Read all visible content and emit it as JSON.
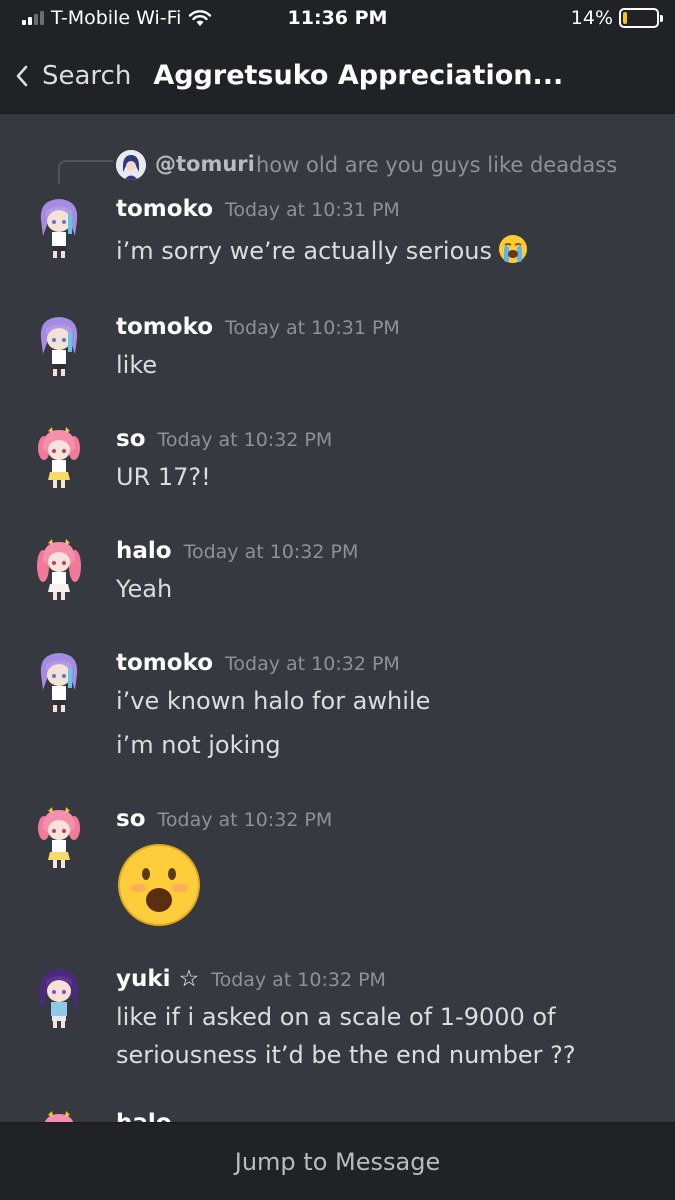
{
  "status_bar": {
    "carrier": "T-Mobile Wi-Fi",
    "time": "11:36 PM",
    "battery": "14%",
    "battery_level": 0.14
  },
  "header": {
    "back_label": "Search",
    "channel_title": "Aggretsuko Appreciation..."
  },
  "reply": {
    "name": "@tomuri",
    "text": "how old are you guys like deadass"
  },
  "messages": [
    {
      "author": "tomoko",
      "timestamp": "Today at 10:31 PM",
      "lines": [
        "i’m sorry we’re actually serious"
      ],
      "emoji": "loudly-crying-face"
    },
    {
      "author": "tomoko",
      "timestamp": "Today at 10:31 PM",
      "lines": [
        "like"
      ]
    },
    {
      "author": "so",
      "timestamp": "Today at 10:32 PM",
      "lines": [
        "UR 17?!"
      ]
    },
    {
      "author": "halo",
      "timestamp": "Today at 10:32 PM",
      "lines": [
        "Yeah"
      ]
    },
    {
      "author": "tomoko",
      "timestamp": "Today at 10:32 PM",
      "lines": [
        "i’ve known halo for awhile",
        "i’m not joking"
      ]
    },
    {
      "author": "so",
      "timestamp": "Today at 10:32 PM",
      "big_emoji": "astonished-face"
    },
    {
      "author": "yuki",
      "author_suffix": "☆",
      "timestamp": "Today at 10:32 PM",
      "lines": [
        "like if i asked on a scale of 1-9000 of",
        "seriousness it’d be the end number ??"
      ]
    }
  ],
  "truncated_author": "halo",
  "footer": {
    "jump_label": "Jump to Message"
  },
  "colors": {
    "background": "#36393f",
    "header": "#202225",
    "text": "#dcddde",
    "muted": "#8e9297",
    "battery": "#f5c518"
  }
}
